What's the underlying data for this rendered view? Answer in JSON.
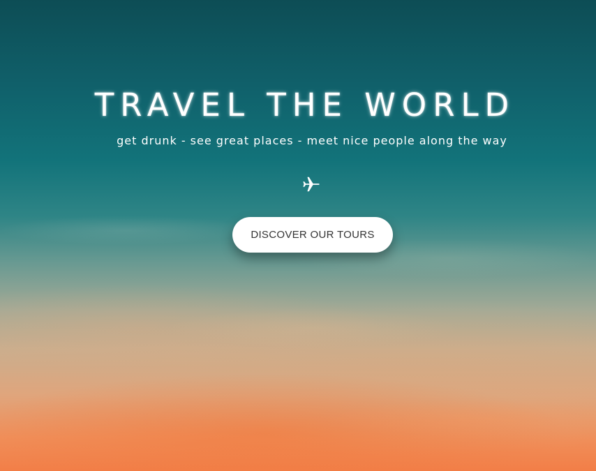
{
  "hero": {
    "headline": "TRAVEL THE WORLD",
    "tagline": "get drunk - see great places - meet nice people along the way",
    "icon": "airplane-icon",
    "cta_label": "DISCOVER OUR TOURS"
  },
  "colors": {
    "sky_top": "#0d4d55",
    "sky_bottom": "#f27e47",
    "text": "#ffffff",
    "button_bg": "#ffffff",
    "button_text": "#333333"
  }
}
